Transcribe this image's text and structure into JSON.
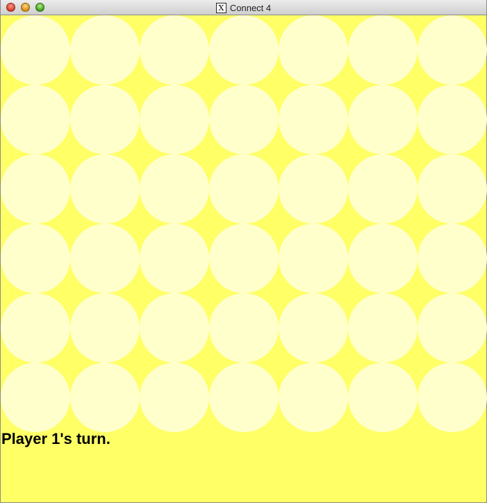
{
  "window": {
    "title": "Connect 4",
    "app_icon": "x11-icon",
    "app_icon_glyph": "X"
  },
  "board": {
    "columns": 7,
    "rows": 6,
    "background_color": "#ffff66",
    "empty_slot_color": "#ffffcc",
    "cells": [
      [
        "empty",
        "empty",
        "empty",
        "empty",
        "empty",
        "empty",
        "empty"
      ],
      [
        "empty",
        "empty",
        "empty",
        "empty",
        "empty",
        "empty",
        "empty"
      ],
      [
        "empty",
        "empty",
        "empty",
        "empty",
        "empty",
        "empty",
        "empty"
      ],
      [
        "empty",
        "empty",
        "empty",
        "empty",
        "empty",
        "empty",
        "empty"
      ],
      [
        "empty",
        "empty",
        "empty",
        "empty",
        "empty",
        "empty",
        "empty"
      ],
      [
        "empty",
        "empty",
        "empty",
        "empty",
        "empty",
        "empty",
        "empty"
      ]
    ]
  },
  "status": {
    "text": "Player 1's turn."
  }
}
